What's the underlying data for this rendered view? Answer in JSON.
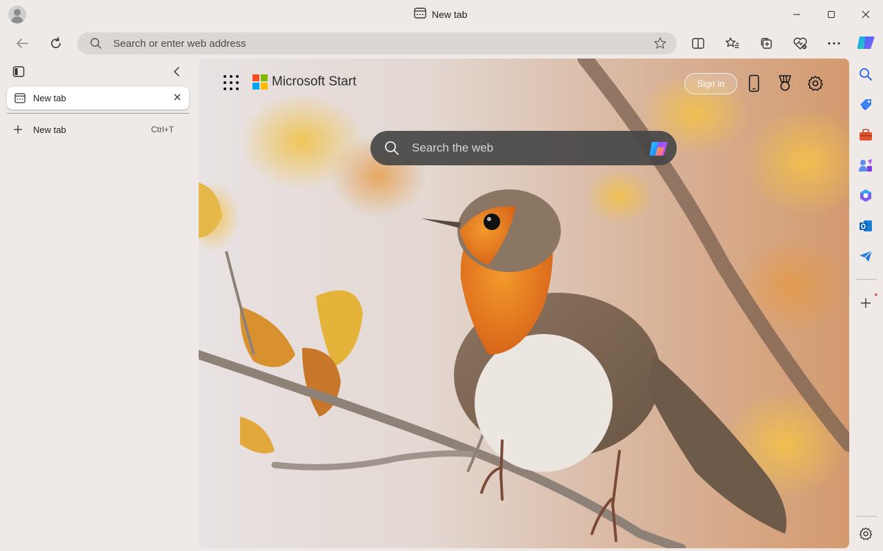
{
  "window": {
    "title": "New tab",
    "controls": [
      "minimize",
      "maximize",
      "close"
    ]
  },
  "toolbar": {
    "address_placeholder": "Search or enter web address",
    "icons": [
      "back-icon",
      "refresh-icon",
      "favorite-star-icon",
      "split-screen-icon",
      "favorites-icon",
      "collections-icon",
      "browser-essentials-icon",
      "more-icon",
      "copilot-icon"
    ]
  },
  "tabs_pane": {
    "tabs": [
      {
        "label": "New tab"
      }
    ],
    "new_tab_label": "New tab",
    "new_tab_shortcut": "Ctrl+T"
  },
  "start_page": {
    "brand": "Microsoft Start",
    "sign_in_label": "Sign in",
    "search_placeholder": "Search the web",
    "brand_colors": [
      "#f25022",
      "#7fba00",
      "#00a4ef",
      "#ffb900"
    ]
  },
  "sidebar": {
    "apps": [
      "search-icon",
      "shopping-icon",
      "tools-icon",
      "games-icon",
      "microsoft365-icon",
      "outlook-icon",
      "drop-icon"
    ],
    "bottom": [
      "add-icon",
      "settings-icon"
    ]
  },
  "colors": {
    "chrome_bg": "#efe9e8",
    "address_bg": "#dcd6d4",
    "accent_blue": "#1a73e8"
  }
}
